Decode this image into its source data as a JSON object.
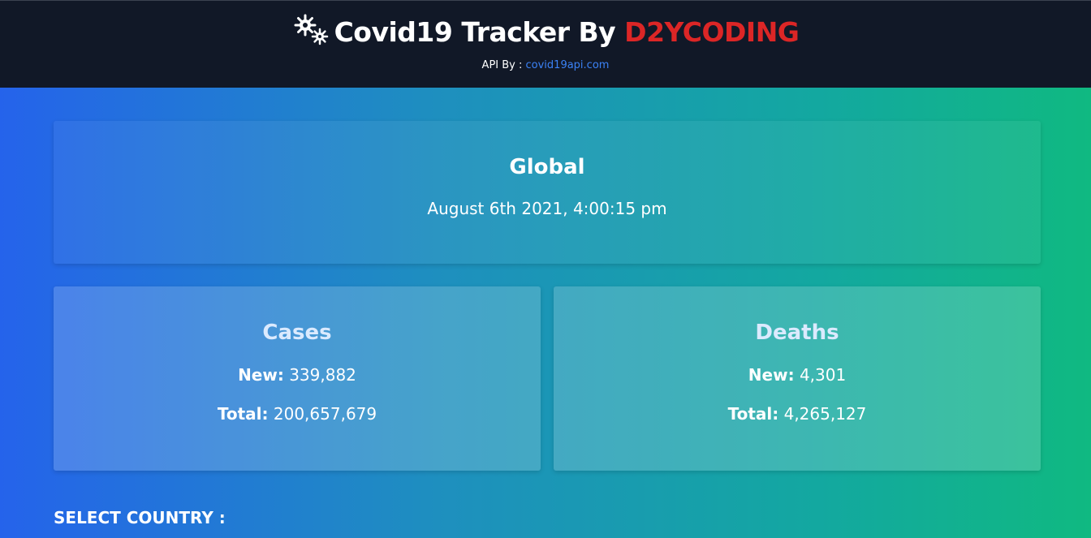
{
  "header": {
    "icon": "virus-icon",
    "title_prefix": "Covid19 Tracker By ",
    "title_brand": "D2YCODING",
    "brand_color": "#dc2626",
    "api_label": "API By :",
    "api_link": "covid19api.com"
  },
  "global": {
    "title": "Global",
    "date": "August 6th 2021, 4:00:15 pm"
  },
  "cases": {
    "title": "Cases",
    "new_label": "New:",
    "new_value": "339,882",
    "total_label": "Total:",
    "total_value": "200,657,679"
  },
  "deaths": {
    "title": "Deaths",
    "new_label": "New:",
    "new_value": "4,301",
    "total_label": "Total:",
    "total_value": "4,265,127"
  },
  "select_country": {
    "label": "SELECT COUNTRY :"
  },
  "colors": {
    "header_bg": "#111827",
    "link": "#3b82f6",
    "gradient_start": "#2563eb",
    "gradient_end": "#10b981"
  }
}
